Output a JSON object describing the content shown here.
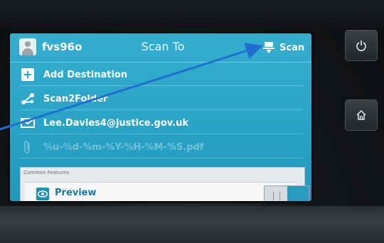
{
  "header": {
    "user": "fvs96o",
    "title": "Scan To",
    "scan_button": "Scan"
  },
  "rows": [
    {
      "label": "Add Destination",
      "icon": "plus-icon"
    },
    {
      "label": "Scan2Folder",
      "icon": "folder-share-icon"
    },
    {
      "label": "Lee.Davies4@justice.gov.uk",
      "icon": "mail-icon"
    },
    {
      "label": "%u-%d-%m-%Y-%H-%M-%S.pdf",
      "icon": "paperclip-icon"
    }
  ],
  "panel": {
    "title": "Common Features",
    "preview_label": "Preview"
  },
  "colors": {
    "screen": "#2ba6c9",
    "arrow": "#1f6fd1"
  }
}
